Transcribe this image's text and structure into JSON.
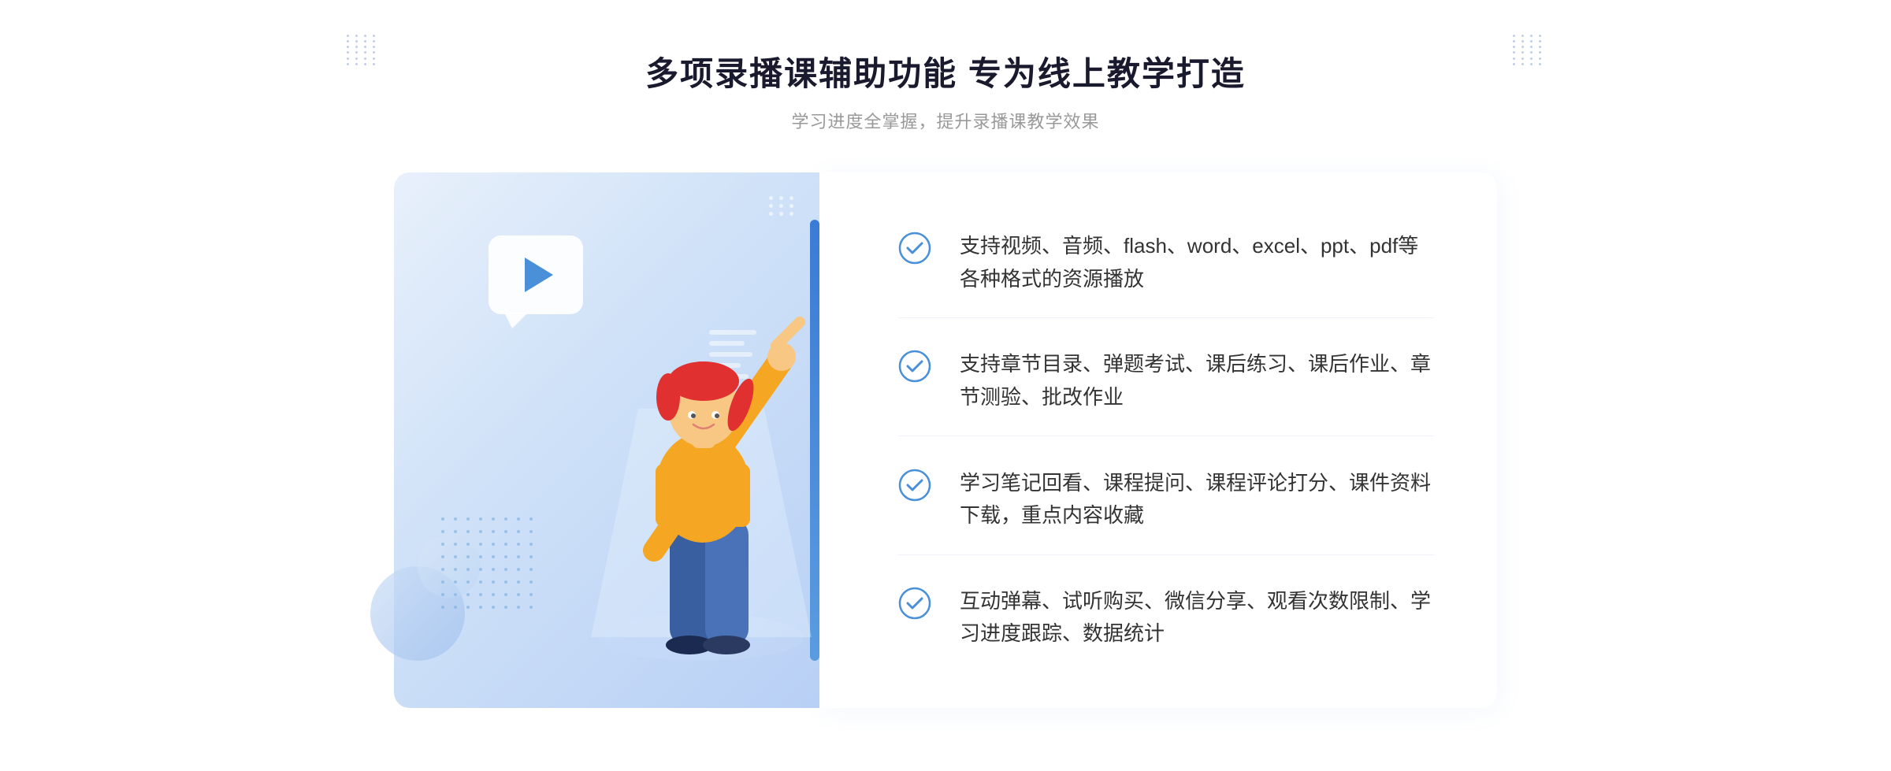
{
  "header": {
    "title": "多项录播课辅助功能 专为线上教学打造",
    "subtitle": "学习进度全掌握，提升录播课教学效果"
  },
  "features": [
    {
      "id": 1,
      "text": "支持视频、音频、flash、word、excel、ppt、pdf等各种格式的资源播放"
    },
    {
      "id": 2,
      "text": "支持章节目录、弹题考试、课后练习、课后作业、章节测验、批改作业"
    },
    {
      "id": 3,
      "text": "学习笔记回看、课程提问、课程评论打分、课件资料下载，重点内容收藏"
    },
    {
      "id": 4,
      "text": "互动弹幕、试听购买、微信分享、观看次数限制、学习进度跟踪、数据统计"
    }
  ],
  "decoration": {
    "chevron": "»",
    "chevron_left": "«"
  }
}
